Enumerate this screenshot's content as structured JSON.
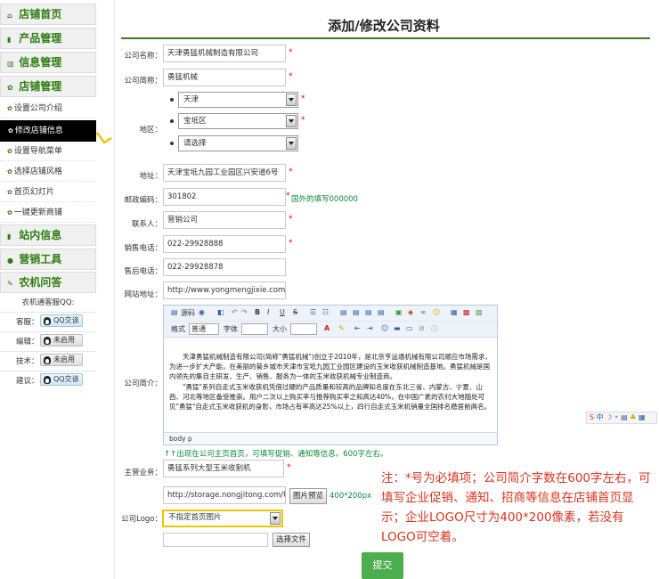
{
  "sidebar": {
    "sections": [
      {
        "label": "店铺首页",
        "icon": "home-icon",
        "glyph": "⌂"
      },
      {
        "label": "产品管理",
        "icon": "list-icon",
        "glyph": "▮"
      },
      {
        "label": "信息管理",
        "icon": "info-icon",
        "glyph": "▥"
      },
      {
        "label": "店铺管理",
        "icon": "gear-icon",
        "glyph": "✿"
      }
    ],
    "shop_items": [
      {
        "label": "设置公司介绍"
      },
      {
        "label": "修改店铺信息"
      },
      {
        "label": "设置导航菜单"
      },
      {
        "label": "选择店铺风格"
      },
      {
        "label": "首页幻灯片"
      },
      {
        "label": "一键更新商铺"
      }
    ],
    "sections2": [
      {
        "label": "站内信息",
        "icon": "message-icon",
        "glyph": "▮"
      },
      {
        "label": "营销工具",
        "icon": "tool-icon",
        "glyph": "●"
      },
      {
        "label": "农机问答",
        "icon": "pencil-icon",
        "glyph": "✎"
      }
    ],
    "qq_header": "农机通客服QQ:",
    "qq_rows": [
      {
        "label": "客服：",
        "status": "QQ交谈"
      },
      {
        "label": "编辑：",
        "status": "未启用"
      },
      {
        "label": "技术：",
        "status": "未启用"
      },
      {
        "label": "建议：",
        "status": "QQ交谈"
      }
    ]
  },
  "page": {
    "title": "添加/修改公司资料"
  },
  "form": {
    "company_name": {
      "label": "公司名称：",
      "value": "天津勇猛机械制造有限公司"
    },
    "short_name": {
      "label": "公司简称：",
      "value": "勇猛机械"
    },
    "region": {
      "label": "地区：",
      "province": "天津",
      "district": "宝坻区",
      "town": "请选择"
    },
    "address": {
      "label": "地址：",
      "value": "天津宝坻九园工业园区兴安道6号"
    },
    "postcode": {
      "label": "邮政编码：",
      "value": "301802",
      "hint": "国外的填写000000"
    },
    "contact": {
      "label": "联系人：",
      "value": "营销公司"
    },
    "sales_phone": {
      "label": "销售电话：",
      "value": "022-29928888"
    },
    "service_phone": {
      "label": "售后电话：",
      "value": "022-29928878"
    },
    "website": {
      "label": "网站地址：",
      "value": "http://www.yongmengjixie.com"
    },
    "intro": {
      "label": "公司简介：",
      "toolbar1": [
        "源码",
        "B",
        "I",
        "U",
        "S"
      ],
      "toolbar2": [
        "格式",
        "普通",
        "字体",
        "大小"
      ],
      "para1": "天津勇猛机械制造有限公司(简称\"勇猛机械\")创立于2010年，是北京亨运通机械有限公司顺应市场需求，为进一步扩大产能，在美丽的菊乡城市天津市宝坻九园工业园区建设的玉米收获机械制造基地。勇猛机械是国内领先的集自主研发、生产、销售、服务为一体的玉米收获机械专业制造商。",
      "para2": "\"勇猛\"系列自走式玉米收获机凭借过硬的产品质量和较高的品牌知名度在东北三省、内蒙古、宁夏、山西、河北等地区备受推崇。用户二次以上购买率与推荐购买率之和高达40%，在中国广袤的农村大地随处可见\"勇猛\"自走式玉米收获机的身影，市场占有率高达25%以上，四行自走式玉米机销量全国排名稳居前两名。",
      "status": "body   p",
      "hint": "↑↑出现在公司主页首页，可填写促销、通知等信息。600字左右。"
    },
    "main_business": {
      "label": "主营业务：",
      "value": "勇猛系列大型玉米收割机"
    },
    "logo": {
      "label": "公司Logo：",
      "url": "http://storage.nongjitong.com/Up",
      "preview_btn": "图片预览",
      "size_hint": "400*200px",
      "select": "不指定首页图片",
      "file_btn": "选择文件"
    },
    "submit": "提交"
  },
  "note": "注：*号为必填项；公司简介字数在600字左右，可填写企业促销、通知、招商等信息在店铺首页显示；企业LOGO尺寸为400*200像素，若没有LOGO可空着。",
  "required_mark": "*",
  "ime": "中",
  "colors": {
    "accent": "#2e7d0f",
    "note": "#d9341e",
    "submit": "#4cae4c"
  }
}
